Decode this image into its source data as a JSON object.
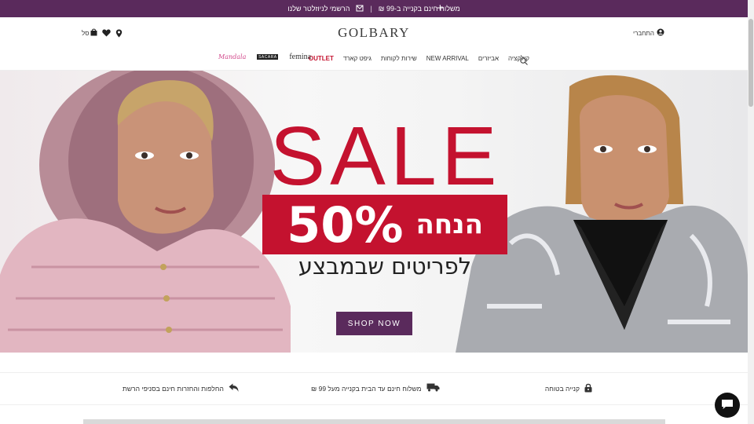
{
  "topbar": {
    "shipping_text": "משלוח חינם בקנייה ב-99 ₪",
    "separator": "|",
    "app_text": "הרשמי לניוזלטר שלנו",
    "plus_label": "+"
  },
  "header": {
    "logo": "GOLBARY",
    "login_label": "התחברי",
    "cart_label": "סל"
  },
  "nav": {
    "items": [
      {
        "label": "קולקציה"
      },
      {
        "label": "אביזרים"
      },
      {
        "label": "NEW ARRIVAL"
      },
      {
        "label": "שירות לקוחות"
      },
      {
        "label": "גיפט קארד"
      },
      {
        "label": "OUTLET"
      }
    ],
    "brands": {
      "femina": "femina",
      "sacara": "SACARA",
      "mandala": "Mandala"
    }
  },
  "hero": {
    "title": "SALE",
    "percent": "50%",
    "discount_word": "הנחה",
    "subtitle": "לפריטים שבמבצע",
    "cta": "SHOP NOW"
  },
  "features": [
    {
      "label": "קנייה בטוחה",
      "icon": "lock-icon"
    },
    {
      "label": "משלוח חינם עד הבית בקנייה מעל 99 ₪",
      "icon": "truck-icon"
    },
    {
      "label": "החלפות והחזרות חינם בסניפי הרשת",
      "icon": "return-arrow-icon"
    }
  ],
  "colors": {
    "brand_purple": "#5a2a5c",
    "sale_red": "#c4122f"
  }
}
